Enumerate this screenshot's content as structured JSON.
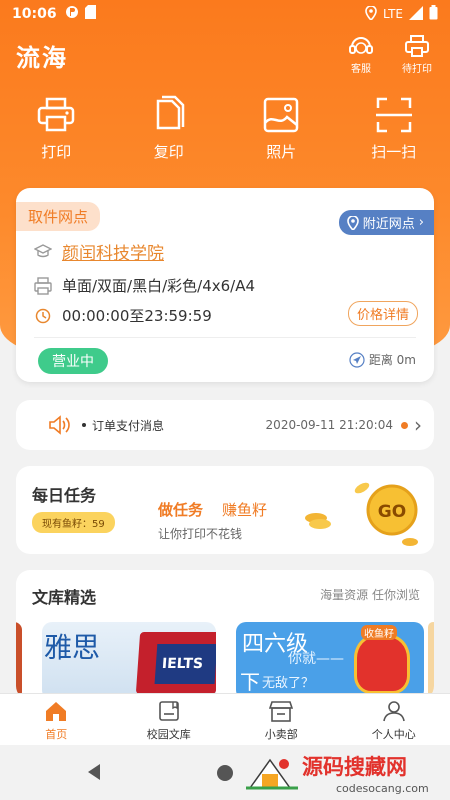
{
  "status_bar": {
    "time": "10:06",
    "network": "LTE"
  },
  "app": {
    "logo": "流海"
  },
  "top_actions": [
    {
      "label": "客服",
      "icon": "customer-service-icon"
    },
    {
      "label": "待打印",
      "icon": "printer-icon"
    }
  ],
  "quick_actions": [
    {
      "label": "打印",
      "icon": "printer-icon"
    },
    {
      "label": "复印",
      "icon": "copy-icon"
    },
    {
      "label": "照片",
      "icon": "photo-icon"
    },
    {
      "label": "扫一扫",
      "icon": "scan-icon"
    }
  ],
  "pickup": {
    "tag": "取件网点",
    "nearby": "附近网点",
    "school": "颜闰科技学院",
    "print_modes": "单面/双面/黑白/彩色/4x6/A4",
    "hours": "00:00:00至23:59:59",
    "price_detail": "价格详情",
    "status": "营业中",
    "distance": "距离 0m"
  },
  "notice": {
    "message": "订单支付消息",
    "datetime": "2020-09-11 21:20:04"
  },
  "tasks": {
    "title": "每日任务",
    "badge": "现有鱼籽：59",
    "do_task": "做任务",
    "earn": "赚鱼籽",
    "subtitle": "让你打印不花钱",
    "go": "GO"
  },
  "library": {
    "title": "文库精选",
    "hint": "海量资源 任你浏览",
    "banner_left": "雅思",
    "banner_left_book": "IELTS",
    "banner_right_title": "四六级",
    "banner_right_line1": "你就——",
    "banner_right_line2": "下",
    "banner_right_line3": "无敌了？",
    "banner_right_bag": "收鱼籽"
  },
  "bottom_nav": [
    {
      "label": "首页",
      "icon": "home-icon",
      "active": true
    },
    {
      "label": "校园文库",
      "icon": "library-icon",
      "active": false
    },
    {
      "label": "小卖部",
      "icon": "shop-icon",
      "active": false
    },
    {
      "label": "个人中心",
      "icon": "user-icon",
      "active": false
    }
  ],
  "watermark": {
    "title": "源码搜藏网",
    "url": "codesocang.com"
  },
  "colors": {
    "brand": "#fb7a1d",
    "accent": "#f07c25",
    "green": "#3fcb8b",
    "blue": "#5680c4"
  }
}
